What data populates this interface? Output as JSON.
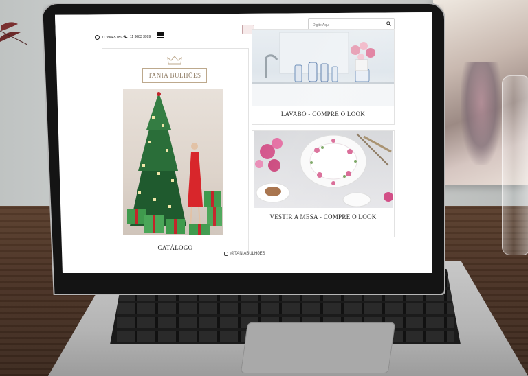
{
  "header": {
    "whatsapp_label": "11 99845 0593",
    "phone_label": "11 3083 3999",
    "search": {
      "placeholder": "Digite Aqui"
    }
  },
  "brand": {
    "name": "TANIA BULHÕES"
  },
  "cards": [
    {
      "caption": "CATÁLOGO"
    },
    {
      "caption": "LAVABO - COMPRE O LOOK"
    },
    {
      "caption": "VESTIR A MESA - COMPRE O LOOK"
    }
  ],
  "footer": {
    "instagram_handle": "@TANIABULHõES"
  },
  "colors": {
    "brand_gold": "#8e7b63",
    "dress_red": "#d8262b",
    "gift_green": "#3f9a4d",
    "flower_pink": "#d24f87"
  }
}
